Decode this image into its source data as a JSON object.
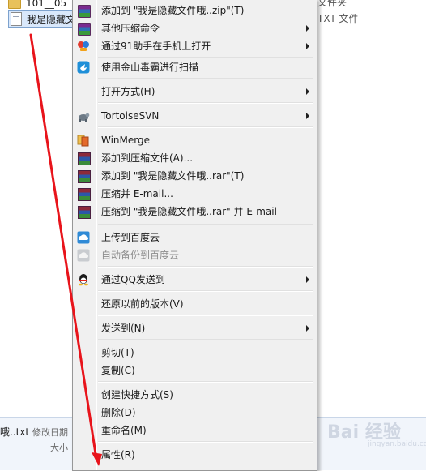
{
  "explorer": {
    "rows": [
      {
        "name": "101__05",
        "type": "文件夹",
        "icon": "folder-icon"
      },
      {
        "name": "我是隐藏文",
        "type": "TXT 文件",
        "icon": "txt-file-icon"
      }
    ],
    "details": {
      "name": "哦..txt",
      "modified_label": "修改日期",
      "size_label": "大小"
    },
    "watermark": "Bai 经验",
    "watermark_sub": "jingyan.baidu.com"
  },
  "context_menu": {
    "items": [
      {
        "label": "添加到 \"我是隐藏文件哦..zip\"(T)",
        "icon": "winrar-zip-icon",
        "submenu": false
      },
      {
        "label": "其他压缩命令",
        "icon": "winrar-zip-icon",
        "submenu": true
      },
      {
        "label": "通过91助手在手机上打开",
        "icon": "91-assistant-icon",
        "submenu": true
      },
      {
        "label": "使用金山毒霸进行扫描",
        "icon": "kingsoft-antivirus-icon",
        "submenu": false
      },
      {
        "label": "打开方式(H)",
        "icon": "",
        "submenu": true
      },
      {
        "label": "TortoiseSVN",
        "icon": "tortoisesvn-icon",
        "submenu": true
      },
      {
        "label": "WinMerge",
        "icon": "winmerge-icon",
        "submenu": false
      },
      {
        "label": "添加到压缩文件(A)...",
        "icon": "winrar-icon",
        "submenu": false
      },
      {
        "label": "添加到 \"我是隐藏文件哦..rar\"(T)",
        "icon": "winrar-icon",
        "submenu": false
      },
      {
        "label": "压缩并 E-mail...",
        "icon": "winrar-icon",
        "submenu": false
      },
      {
        "label": "压缩到 \"我是隐藏文件哦..rar\" 并 E-mail",
        "icon": "winrar-icon",
        "submenu": false
      },
      {
        "label": "上传到百度云",
        "icon": "baidu-cloud-icon",
        "submenu": false
      },
      {
        "label": "自动备份到百度云",
        "icon": "baidu-cloud-backup-icon",
        "submenu": false,
        "disabled": true
      },
      {
        "label": "通过QQ发送到",
        "icon": "qq-icon",
        "submenu": true
      },
      {
        "label": "还原以前的版本(V)",
        "icon": "",
        "submenu": false
      },
      {
        "label": "发送到(N)",
        "icon": "",
        "submenu": true
      },
      {
        "label": "剪切(T)",
        "icon": "",
        "submenu": false
      },
      {
        "label": "复制(C)",
        "icon": "",
        "submenu": false
      },
      {
        "label": "创建快捷方式(S)",
        "icon": "",
        "submenu": false
      },
      {
        "label": "删除(D)",
        "icon": "",
        "submenu": false
      },
      {
        "label": "重命名(M)",
        "icon": "",
        "submenu": false
      },
      {
        "label": "属性(R)",
        "icon": "",
        "submenu": false
      }
    ]
  },
  "annotation": {
    "color": "#e8141b"
  }
}
